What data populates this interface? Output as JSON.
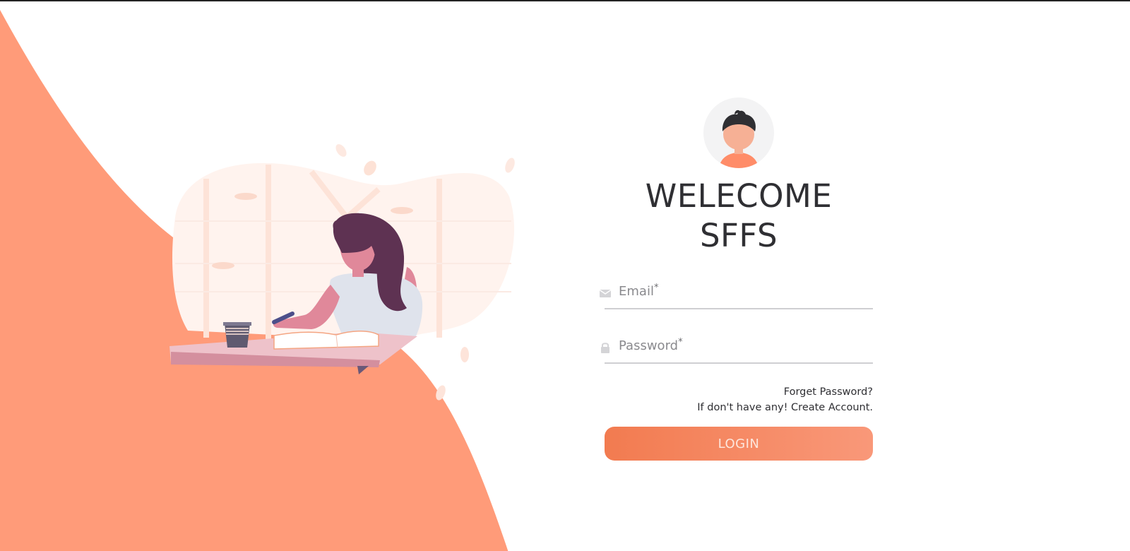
{
  "header": {
    "title_line1": "WELECOME",
    "title_line2": "SFFS"
  },
  "form": {
    "email": {
      "label": "Email",
      "required_mark": "*",
      "value": "",
      "icon": "envelope-icon"
    },
    "password": {
      "label": "Password",
      "required_mark": "*",
      "value": "",
      "icon": "lock-icon"
    },
    "forget_password_link": "Forget Password?",
    "create_account_link": "If don't have any! Create Account.",
    "login_button": "LOGIN"
  },
  "colors": {
    "accent": "#ff9b79",
    "button_start": "#f27b50",
    "button_end": "#f99879",
    "title_text": "#2f2f33",
    "field_line": "#cfcfd2"
  },
  "avatar": {
    "icon": "user-avatar-icon"
  },
  "illustration": {
    "icon": "woman-writing-illustration"
  }
}
